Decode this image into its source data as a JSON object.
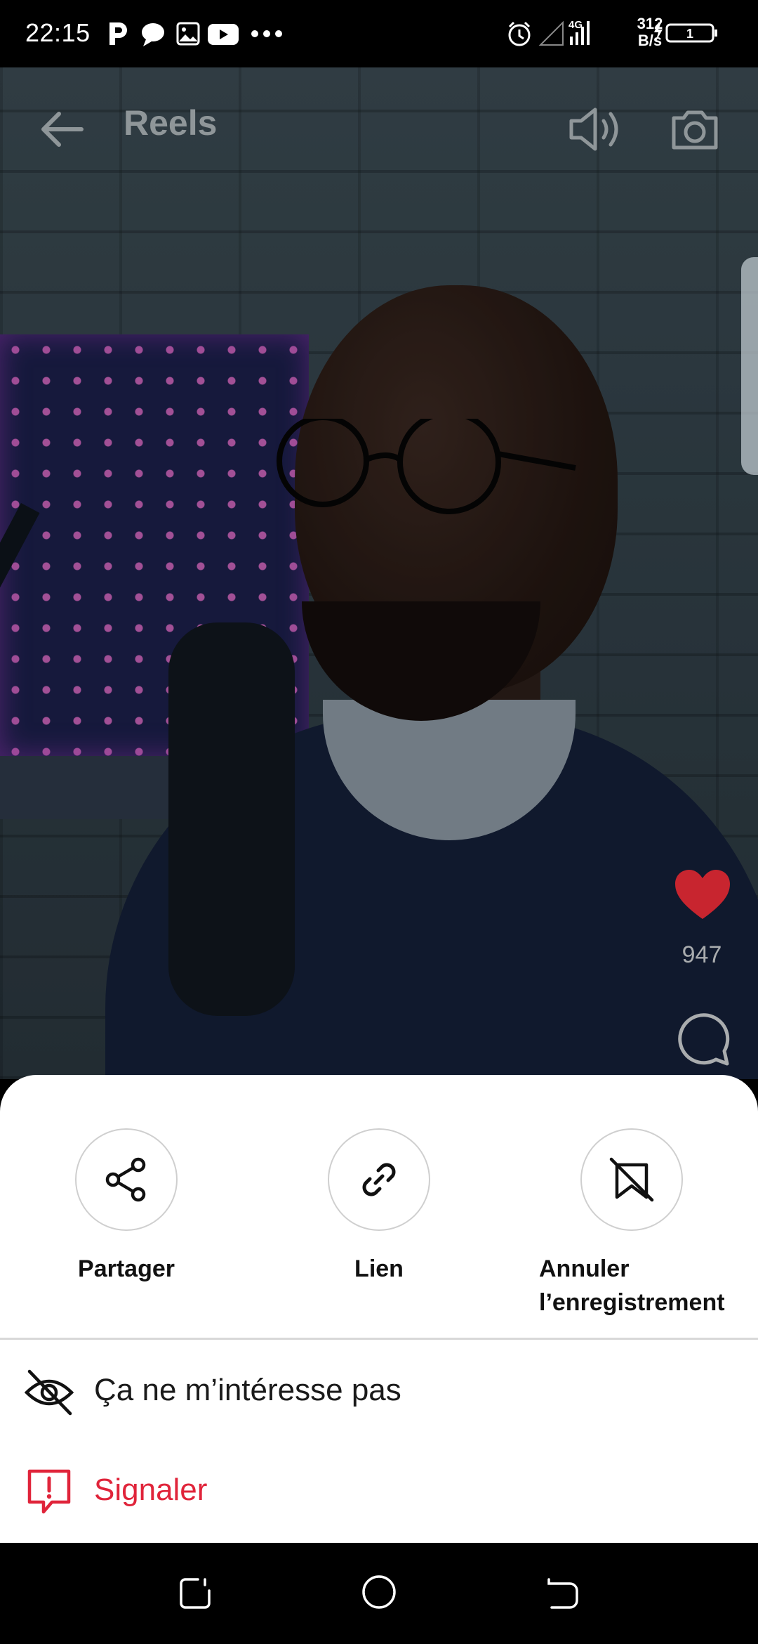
{
  "status_bar": {
    "time": "22:15",
    "network_speed_value": "312",
    "network_speed_unit": "B/s",
    "network_type": "4G",
    "battery_level": "1"
  },
  "reel_header": {
    "title": "Reels"
  },
  "reel_side": {
    "like_count": "947"
  },
  "sheet": {
    "actions": [
      {
        "label": "Partager",
        "icon": "share-icon"
      },
      {
        "label": "Lien",
        "icon": "link-icon"
      },
      {
        "label_line1": "Annuler",
        "label_line2": "l’enregistrement",
        "icon": "bookmark-off-icon"
      }
    ],
    "menu": [
      {
        "label": "Ça ne m’intéresse pas",
        "icon": "eye-off-icon"
      },
      {
        "label": "Signaler",
        "icon": "report-icon"
      }
    ]
  },
  "colors": {
    "like_red": "#c8252f",
    "report_red": "#e0243a",
    "sheet_bg": "#ffffff"
  }
}
